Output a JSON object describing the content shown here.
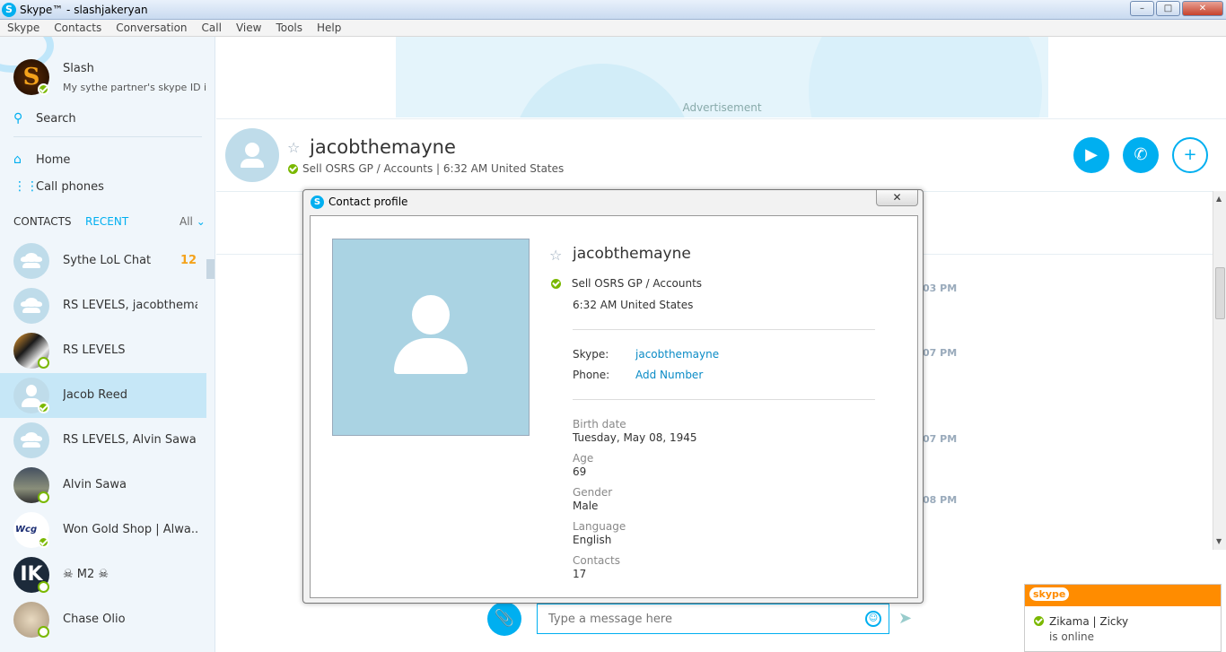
{
  "window": {
    "title": "Skype™ - slashjakeryan",
    "logo_letter": "S",
    "min_label": "–",
    "max_label": "□",
    "close_label": "✕"
  },
  "menu": [
    "Skype",
    "Contacts",
    "Conversation",
    "Call",
    "View",
    "Tools",
    "Help"
  ],
  "profile": {
    "avatar_letter": "S",
    "name": "Slash",
    "mood": "My sythe partner's skype ID i..."
  },
  "sidebar": {
    "search_label": "Search",
    "home_label": "Home",
    "call_phones_label": "Call phones",
    "tab_contacts": "CONTACTS",
    "tab_recent": "RECENT",
    "filter_label": "All"
  },
  "contacts": [
    {
      "name": "Sythe LoL Chat",
      "badge": "12"
    },
    {
      "name": "RS LEVELS, jacobthema...",
      "badge": ""
    },
    {
      "name": "RS LEVELS",
      "badge": ""
    },
    {
      "name": "Jacob Reed",
      "badge": ""
    },
    {
      "name": "RS LEVELS, Alvin Sawa",
      "badge": ""
    },
    {
      "name": "Alvin Sawa",
      "badge": ""
    },
    {
      "name": "Won Gold Shop | Alwa...",
      "badge": ""
    },
    {
      "name": "☠ M2 ☠",
      "badge": ""
    },
    {
      "name": "Chase Olio",
      "badge": ""
    }
  ],
  "contact_avatar_text": {
    "won_gold": "Wcg",
    "m2": "IK"
  },
  "ad": {
    "label": "Advertisement"
  },
  "chat": {
    "name": "jacobthemayne",
    "status": "Sell OSRS GP / Accounts  |  6:32 AM United States",
    "timestamps": [
      "03 PM",
      "07 PM",
      "07 PM",
      "08 PM"
    ],
    "composer_placeholder": "Type a message here"
  },
  "dialog": {
    "title": "Contact profile",
    "name": "jacobthemayne",
    "mood": "Sell OSRS GP / Accounts",
    "local_time": "6:32 AM United States",
    "skype_label": "Skype:",
    "skype_value": "jacobthemayne",
    "phone_label": "Phone:",
    "phone_value": "Add Number",
    "fields": [
      {
        "label": "Birth date",
        "value": "Tuesday, May 08, 1945"
      },
      {
        "label": "Age",
        "value": "69"
      },
      {
        "label": "Gender",
        "value": "Male"
      },
      {
        "label": "Language",
        "value": "English"
      },
      {
        "label": "Contacts",
        "value": "17"
      }
    ]
  },
  "toast": {
    "brand": "skype",
    "name": "Zikama  | Zicky",
    "status": "is online"
  },
  "colors": {
    "accent": "#00aff0",
    "online": "#7ab800",
    "toast_bar": "#ff8c00"
  }
}
